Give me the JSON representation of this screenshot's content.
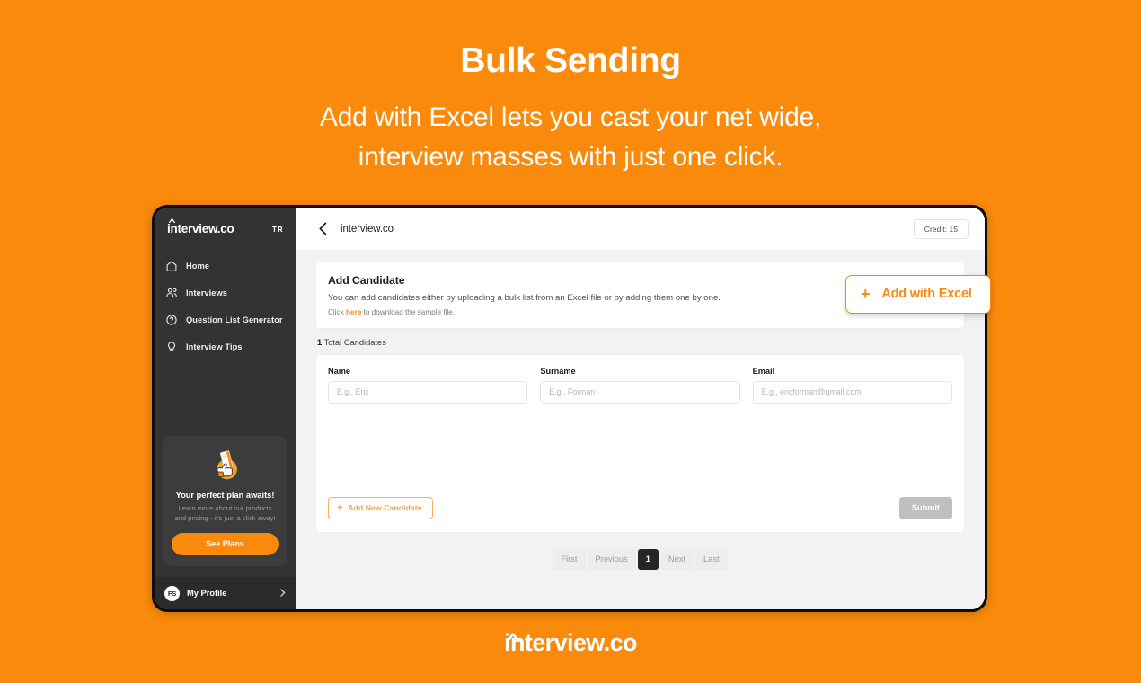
{
  "promo": {
    "title": "Bulk Sending",
    "subtitle_line1": "Add with Excel lets you cast your net wide,",
    "subtitle_line2": "interview masses with just one click.",
    "accent_color": "#F98A0C",
    "footer_logo": "interview.co"
  },
  "sidebar": {
    "brand": "interview.co",
    "language": "TR",
    "items": [
      {
        "label": "Home",
        "icon": "home-icon"
      },
      {
        "label": "Interviews",
        "icon": "users-icon"
      },
      {
        "label": "Question List Generator",
        "icon": "question-circle-icon"
      },
      {
        "label": "Interview Tips",
        "icon": "lightbulb-icon"
      }
    ],
    "plan_card": {
      "title": "Your perfect plan awaits!",
      "description": "Learn more about our products and pricing - it's just a click away!",
      "button_label": "See Plans",
      "illustration": "hand-holding-card-illustration"
    },
    "profile": {
      "initials": "FS",
      "label": "My Profile",
      "chevron": "chevron-right-icon"
    }
  },
  "topbar": {
    "back_icon": "chevron-left-icon",
    "title": "interview.co",
    "credit_label": "Credit:  15"
  },
  "main": {
    "intro": {
      "title": "Add Candidate",
      "description": "You can add candidates either by uploading a bulk list from an Excel file or by adding them one by one.",
      "note_prefix": "Click ",
      "note_link": "here",
      "note_suffix": " to download the sample file."
    },
    "total_count": "1",
    "total_label": " Total Candidates",
    "fields": [
      {
        "label": "Name",
        "placeholder": "E.g., Eric",
        "value": ""
      },
      {
        "label": "Surname",
        "placeholder": "E.g., Forman",
        "value": ""
      },
      {
        "label": "Email",
        "placeholder": "E.g., ericforman@gmail.com",
        "value": ""
      }
    ],
    "add_candidate_label": "Add New Candidate",
    "submit_label": "Submit",
    "pagination": {
      "first": "First",
      "previous": "Previous",
      "current": "1",
      "next": "Next",
      "last": "Last"
    }
  },
  "floating": {
    "excel_button_label": "Add with Excel"
  }
}
